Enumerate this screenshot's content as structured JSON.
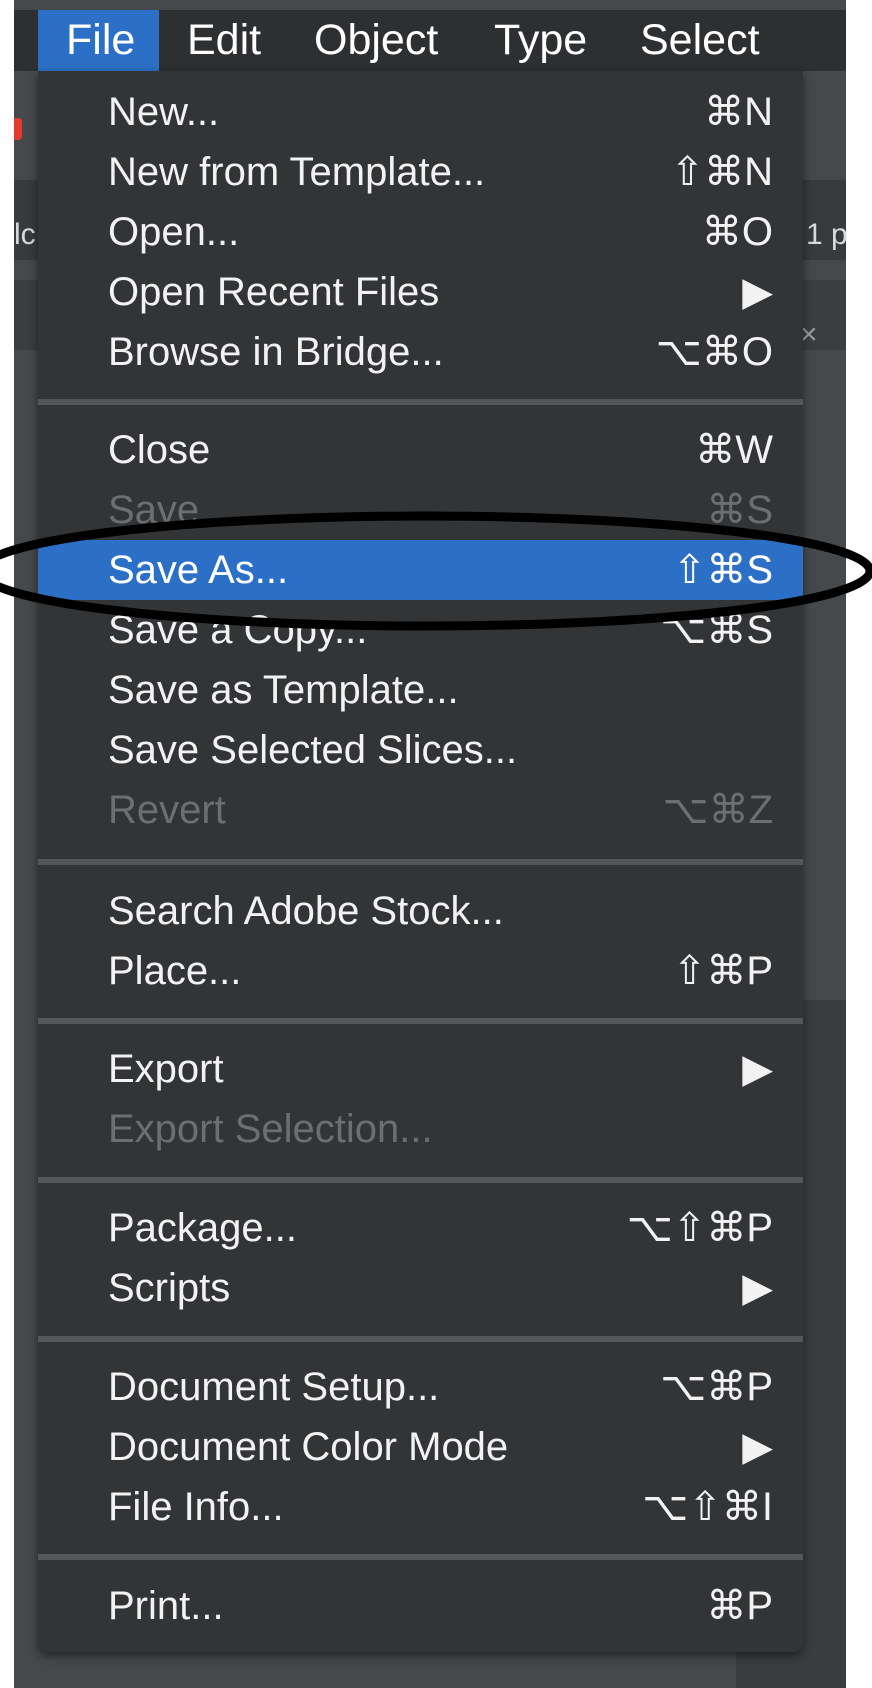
{
  "menubar": {
    "items": [
      "File",
      "Edit",
      "Object",
      "Type",
      "Select"
    ],
    "active": "File"
  },
  "background_fragments": {
    "left_text": "lc",
    "right_text": "1 p",
    "close_glyph": "×"
  },
  "menu": {
    "items": [
      {
        "label": "New...",
        "shortcut": "⌘N",
        "enabled": true
      },
      {
        "label": "New from Template...",
        "shortcut": "⇧⌘N",
        "enabled": true
      },
      {
        "label": "Open...",
        "shortcut": "⌘O",
        "enabled": true
      },
      {
        "label": "Open Recent Files",
        "shortcut": "▶",
        "enabled": true
      },
      {
        "label": "Browse in Bridge...",
        "shortcut": "⌥⌘O",
        "enabled": true
      },
      {
        "label": "Close",
        "shortcut": "⌘W",
        "enabled": true
      },
      {
        "label": "Save",
        "shortcut": "⌘S",
        "enabled": false
      },
      {
        "label": "Save As...",
        "shortcut": "⇧⌘S",
        "enabled": true,
        "highlighted": true
      },
      {
        "label": "Save a Copy...",
        "shortcut": "⌥⌘S",
        "enabled": true
      },
      {
        "label": "Save as Template...",
        "shortcut": "",
        "enabled": true
      },
      {
        "label": "Save Selected Slices...",
        "shortcut": "",
        "enabled": true
      },
      {
        "label": "Revert",
        "shortcut": "⌥⌘Z",
        "enabled": false
      },
      {
        "label": "Search Adobe Stock...",
        "shortcut": "",
        "enabled": true
      },
      {
        "label": "Place...",
        "shortcut": "⇧⌘P",
        "enabled": true
      },
      {
        "label": "Export",
        "shortcut": "▶",
        "enabled": true
      },
      {
        "label": "Export Selection...",
        "shortcut": "",
        "enabled": false
      },
      {
        "label": "Package...",
        "shortcut": "⌥⇧⌘P",
        "enabled": true
      },
      {
        "label": "Scripts",
        "shortcut": "▶",
        "enabled": true
      },
      {
        "label": "Document Setup...",
        "shortcut": "⌥⌘P",
        "enabled": true
      },
      {
        "label": "Document Color Mode",
        "shortcut": "▶",
        "enabled": true
      },
      {
        "label": "File Info...",
        "shortcut": "⌥⇧⌘I",
        "enabled": true
      },
      {
        "label": "Print...",
        "shortcut": "⌘P",
        "enabled": true
      }
    ]
  },
  "colors": {
    "highlight": "#2c6fc6",
    "menu_bg": "#323436",
    "annotation_ring": "#000000"
  }
}
